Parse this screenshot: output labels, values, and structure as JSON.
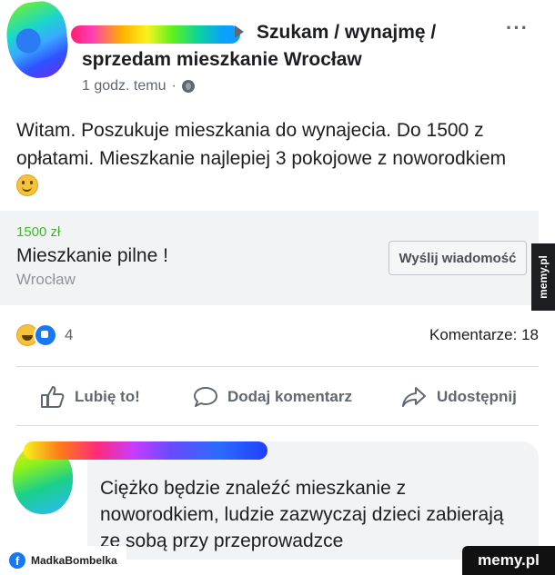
{
  "post": {
    "group_line1": "Szukam / wynajmę /",
    "group_line2": "sprzedam mieszkanie Wrocław",
    "time": "1 godz. temu",
    "separator": "·",
    "more": "···",
    "text": "Witam. Poszukuje mieszkania do wynajecia. Do 1500 z opłatami. Mieszkanie najlepiej 3 pokojowe z noworodkiem"
  },
  "sale": {
    "price": "1500 zł",
    "title": "Mieszkanie pilne !",
    "location": "Wrocław",
    "message_button": "Wyślij wiadomość"
  },
  "stats": {
    "reactions_count": "4",
    "comments": "Komentarze: 18"
  },
  "actions": {
    "like": "Lubię to!",
    "comment": "Dodaj komentarz",
    "share": "Udostępnij"
  },
  "comment": {
    "text": "Ciężko będzie znaleźć mieszkanie z noworodkiem, ludzie zazwyczaj dzieci zabierają ze sobą przy przeprowadzce"
  },
  "watermark": {
    "side": "memy.pl",
    "bottom": "memy.pl",
    "credit": "MadkaBombelka",
    "fb_letter": "f"
  },
  "icons": [
    "globe-icon",
    "more-icon",
    "smiley-icon",
    "haha-reaction-icon",
    "like-reaction-icon",
    "thumbs-up-icon",
    "comment-icon",
    "share-icon",
    "facebook-icon"
  ],
  "colors": {
    "price_green": "#42b72a",
    "muted": "#606770",
    "fb_blue": "#1877f2"
  }
}
